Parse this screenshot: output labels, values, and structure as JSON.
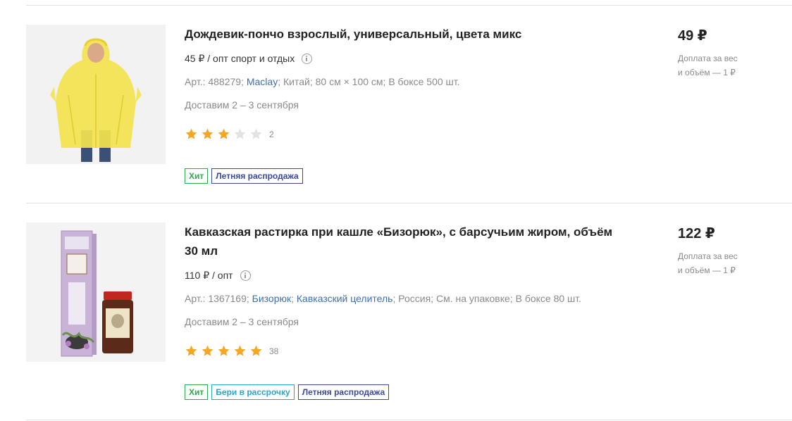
{
  "currency_icon": "ruble-sign",
  "colors": {
    "star_filled": "#f5a623",
    "star_empty": "#e2e2e2",
    "link": "#3e6fb0",
    "badge_hit": "#2fa84f",
    "badge_installment": "#27a7c4",
    "badge_sale": "#3b4a9a"
  },
  "products": [
    {
      "title": "Дождевик-пончо взрослый, универсальный, цвета микс",
      "opt": "45 ₽ / опт спорт и отдых",
      "meta": {
        "article": "Арт.: 488279;",
        "brand": "Maclay",
        "brand_sep": ";",
        "country": "Китай;",
        "size": "80 см × 100 см;",
        "box": "В боксе 500 шт."
      },
      "delivery": "Доставим 2 – 3 сентября",
      "rating": 3,
      "reviews": "2",
      "badges": [
        "Хит",
        "Летняя распродажа"
      ],
      "price": "49 ₽",
      "surcharge_line1": "Доплата за вес",
      "surcharge_line2": "и объём — 1 ₽"
    },
    {
      "title": "Кавказская растирка при кашле «Бизорюк», с барсучьим жиром, объём 30 мл",
      "opt": "110 ₽ / опт",
      "meta": {
        "article": "Арт.: 1367169;",
        "brand": "Бизорюк",
        "brand_sep": ";",
        "brand2": "Кавказский целитель",
        "brand2_sep": ";",
        "country": "Россия;",
        "size": "См. на упаковке;",
        "box": "В боксе 80 шт."
      },
      "delivery": "Доставим 2 – 3 сентября",
      "rating": 5,
      "reviews": "38",
      "badges": [
        "Хит",
        "Бери в рассрочку",
        "Летняя распродажа"
      ],
      "price": "122 ₽",
      "surcharge_line1": "Доплата за вес",
      "surcharge_line2": "и объём — 1 ₽"
    }
  ]
}
